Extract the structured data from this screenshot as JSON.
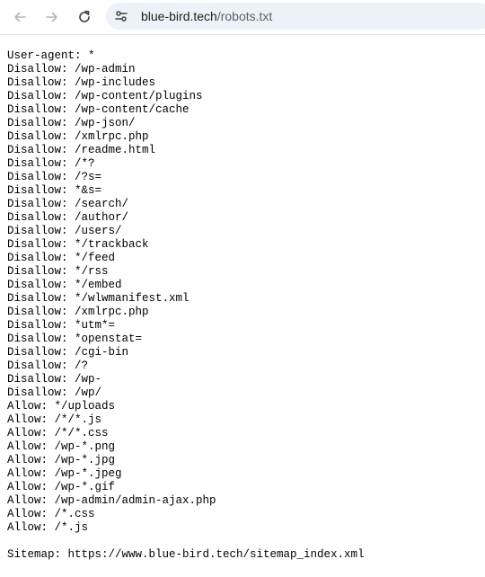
{
  "browser": {
    "url_host": "blue-bird.tech",
    "url_path": "/robots.txt",
    "icons": {
      "back": "arrow-left-icon",
      "forward": "arrow-right-icon",
      "reload": "reload-icon",
      "site_info": "tune-icon"
    },
    "colors": {
      "icon": "#5f6368",
      "icon_disabled": "#b5b7ba",
      "omnibox_bg": "#edf1f8"
    }
  },
  "document": {
    "lines": [
      "User-agent: *",
      "Disallow: /wp-admin",
      "Disallow: /wp-includes",
      "Disallow: /wp-content/plugins",
      "Disallow: /wp-content/cache",
      "Disallow: /wp-json/",
      "Disallow: /xmlrpc.php",
      "Disallow: /readme.html",
      "Disallow: /*?",
      "Disallow: /?s=",
      "Disallow: *&s=",
      "Disallow: /search/",
      "Disallow: /author/",
      "Disallow: /users/",
      "Disallow: */trackback",
      "Disallow: */feed",
      "Disallow: */rss",
      "Disallow: */embed",
      "Disallow: */wlwmanifest.xml",
      "Disallow: /xmlrpc.php",
      "Disallow: *utm*=",
      "Disallow: *openstat=",
      "Disallow: /cgi-bin",
      "Disallow: /?",
      "Disallow: /wp-",
      "Disallow: /wp/",
      "Allow: */uploads",
      "Allow: /*/*.js",
      "Allow: /*/*.css",
      "Allow: /wp-*.png",
      "Allow: /wp-*.jpg",
      "Allow: /wp-*.jpeg",
      "Allow: /wp-*.gif",
      "Allow: /wp-admin/admin-ajax.php",
      "Allow: /*.css",
      "Allow: /*.js",
      "",
      "Sitemap: https://www.blue-bird.tech/sitemap_index.xml"
    ]
  }
}
